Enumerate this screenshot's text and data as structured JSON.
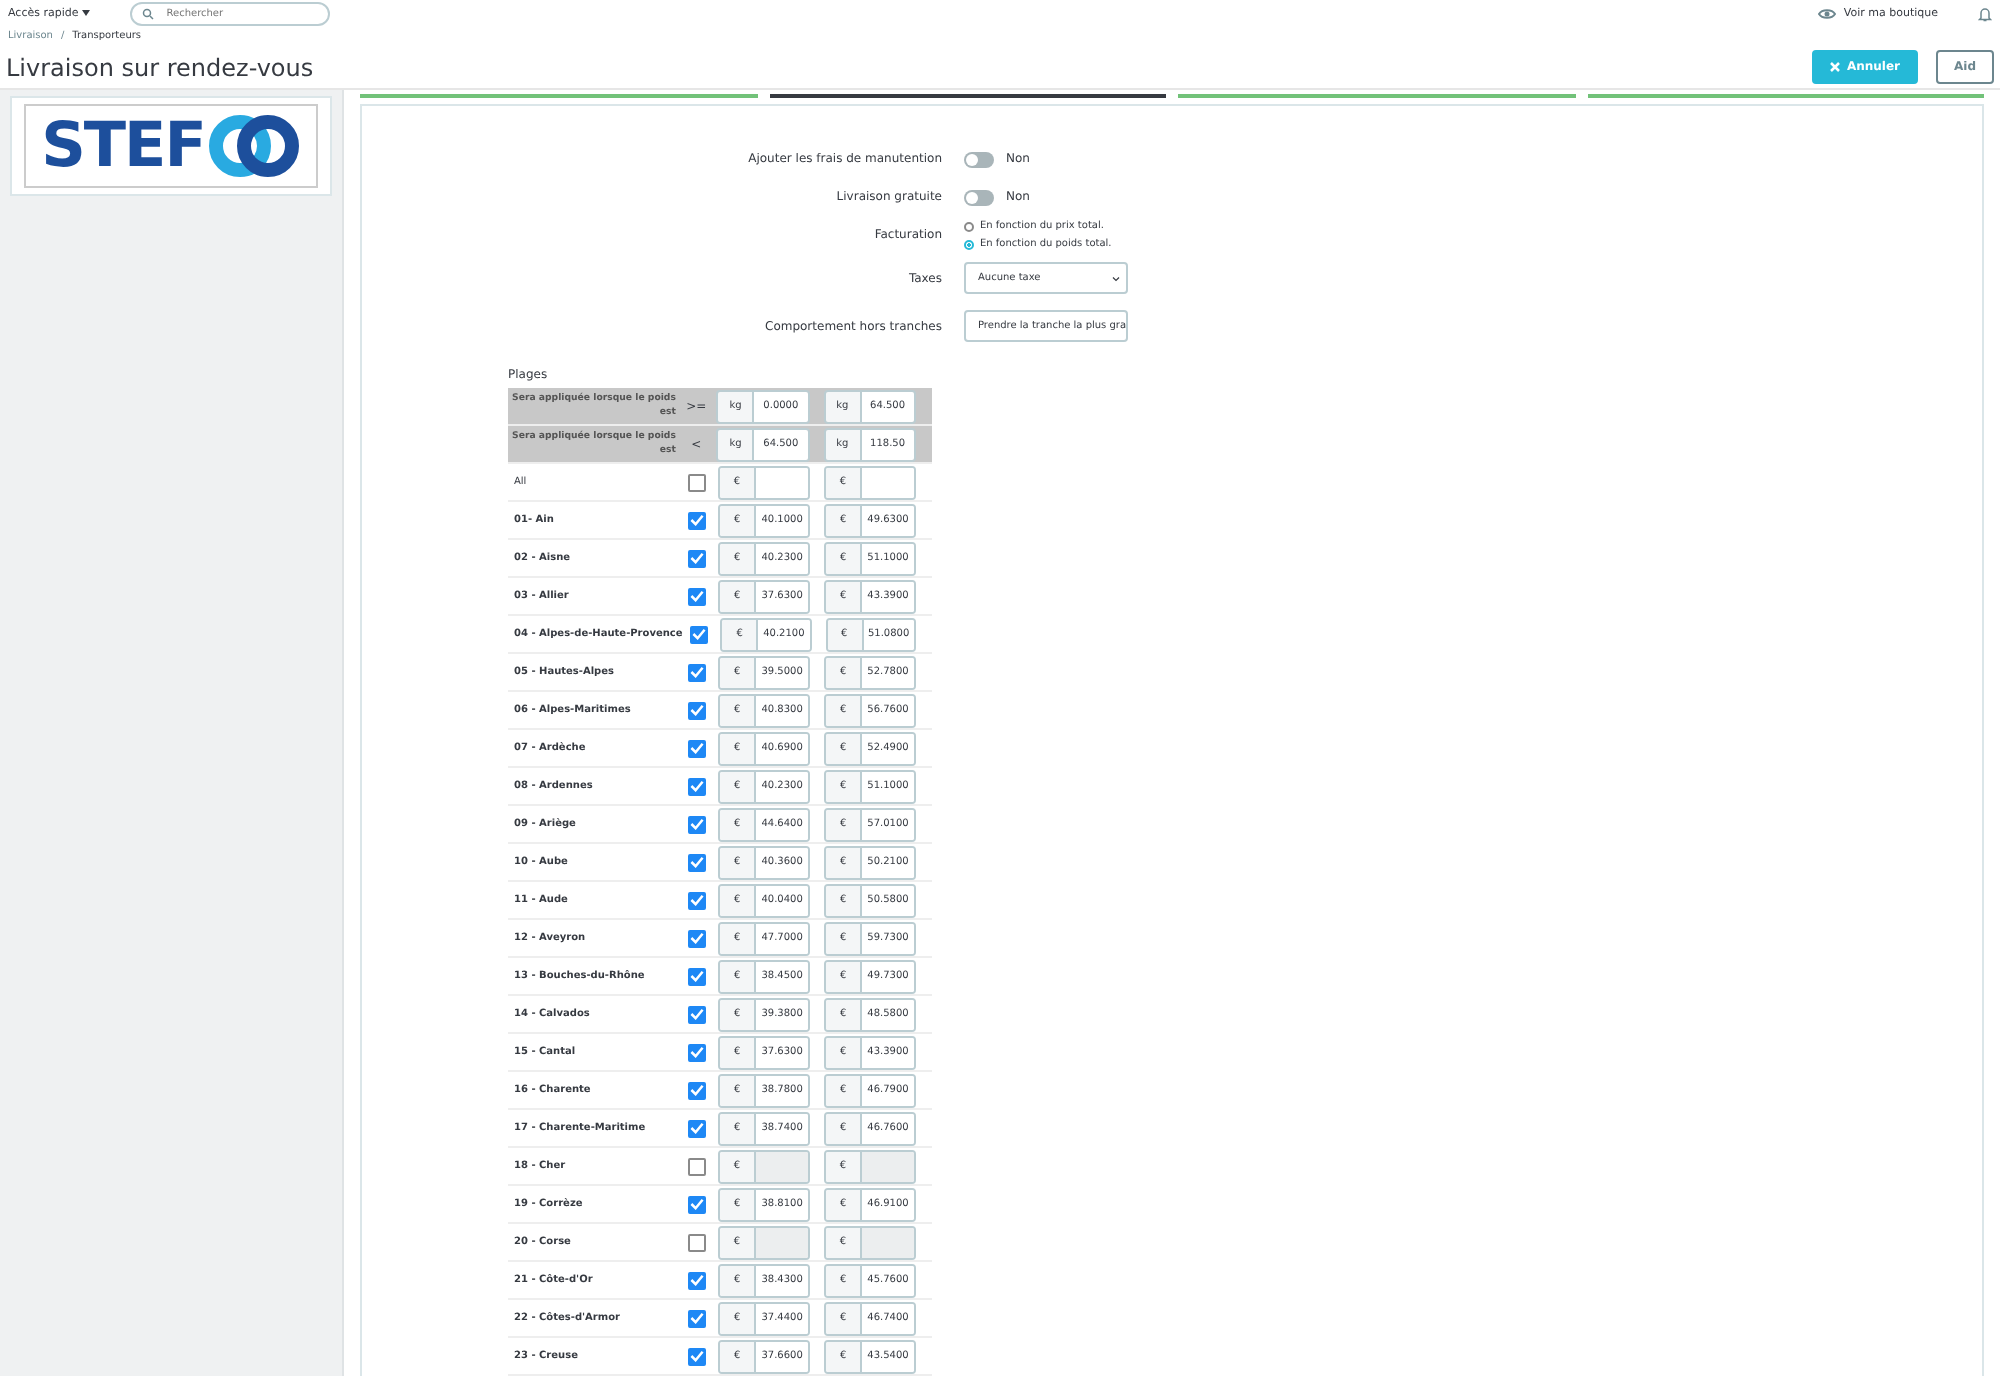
{
  "topbar": {
    "quick_access": "Accès rapide",
    "search": {
      "placeholder": "Rechercher"
    },
    "shop_link": "Voir ma boutique"
  },
  "breadcrumb": {
    "separator": "/",
    "items": [
      "Livraison",
      "Transporteurs"
    ]
  },
  "title": "Livraison sur rendez-vous",
  "actions": [
    {
      "kind": "primary",
      "label": "Annuler"
    },
    {
      "kind": "secondary",
      "label": "Aid"
    }
  ],
  "logo": {
    "text": "STEF"
  },
  "steps": [
    {
      "selected": false
    },
    {
      "selected": true
    },
    {
      "selected": false
    },
    {
      "selected": false
    }
  ],
  "form": {
    "fields": [
      {
        "kind": "toggle",
        "label": "Ajouter les frais de manutention",
        "on": false,
        "value": "Non"
      },
      {
        "kind": "toggle",
        "label": "Livraison gratuite",
        "on": false,
        "value": "Non"
      },
      {
        "kind": "radio",
        "label": "Facturation",
        "options": [
          {
            "label": "En fonction du prix total.",
            "selected": false
          },
          {
            "label": "En fonction du poids total.",
            "selected": true
          }
        ]
      },
      {
        "kind": "select",
        "label": "Taxes",
        "value": "Aucune taxe"
      },
      {
        "kind": "select",
        "label": "Comportement hors tranches",
        "value": "Prendre la tranche la plus gra"
      }
    ]
  },
  "ranges": {
    "title": "Plages",
    "headers": [
      {
        "label": "Sera appliquée lorsque le poids est",
        "operator": ">=",
        "unit_1": "kg",
        "value_1": "0.0000",
        "unit_2": "kg",
        "value_2": "64.500"
      },
      {
        "label": "Sera appliquée lorsque le poids est",
        "operator": "<",
        "unit_1": "kg",
        "value_1": "64.500",
        "unit_2": "kg",
        "value_2": "118.50"
      }
    ],
    "currency": "€",
    "rows": [
      {
        "zone": "All",
        "checked": false,
        "price_1": "",
        "price_2": "",
        "kind": "all"
      },
      {
        "zone": "01- Ain",
        "checked": true,
        "price_1": "40.1000",
        "price_2": "49.6300"
      },
      {
        "zone": "02 - Aisne",
        "checked": true,
        "price_1": "40.2300",
        "price_2": "51.1000"
      },
      {
        "zone": "03 - Allier",
        "checked": true,
        "price_1": "37.6300",
        "price_2": "43.3900"
      },
      {
        "zone": "04 - Alpes-de-Haute-Provence",
        "checked": true,
        "price_1": "40.2100",
        "price_2": "51.0800"
      },
      {
        "zone": "05 - Hautes-Alpes",
        "checked": true,
        "price_1": "39.5000",
        "price_2": "52.7800"
      },
      {
        "zone": "06 - Alpes-Maritimes",
        "checked": true,
        "price_1": "40.8300",
        "price_2": "56.7600"
      },
      {
        "zone": "07 - Ardèche",
        "checked": true,
        "price_1": "40.6900",
        "price_2": "52.4900"
      },
      {
        "zone": "08 - Ardennes",
        "checked": true,
        "price_1": "40.2300",
        "price_2": "51.1000"
      },
      {
        "zone": "09 - Ariège",
        "checked": true,
        "price_1": "44.6400",
        "price_2": "57.0100"
      },
      {
        "zone": "10 - Aube",
        "checked": true,
        "price_1": "40.3600",
        "price_2": "50.2100"
      },
      {
        "zone": "11 - Aude",
        "checked": true,
        "price_1": "40.0400",
        "price_2": "50.5800"
      },
      {
        "zone": "12 - Aveyron",
        "checked": true,
        "price_1": "47.7000",
        "price_2": "59.7300"
      },
      {
        "zone": "13 - Bouches-du-Rhône",
        "checked": true,
        "price_1": "38.4500",
        "price_2": "49.7300"
      },
      {
        "zone": "14 - Calvados",
        "checked": true,
        "price_1": "39.3800",
        "price_2": "48.5800"
      },
      {
        "zone": "15 - Cantal",
        "checked": true,
        "price_1": "37.6300",
        "price_2": "43.3900"
      },
      {
        "zone": "16 - Charente",
        "checked": true,
        "price_1": "38.7800",
        "price_2": "46.7900"
      },
      {
        "zone": "17 - Charente-Maritime",
        "checked": true,
        "price_1": "38.7400",
        "price_2": "46.7600"
      },
      {
        "zone": "18 - Cher",
        "checked": false,
        "price_1": "",
        "price_2": ""
      },
      {
        "zone": "19 - Corrèze",
        "checked": true,
        "price_1": "38.8100",
        "price_2": "46.9100"
      },
      {
        "zone": "20 - Corse",
        "checked": false,
        "price_1": "",
        "price_2": ""
      },
      {
        "zone": "21 - Côte-d'Or",
        "checked": true,
        "price_1": "38.4300",
        "price_2": "45.7600"
      },
      {
        "zone": "22 - Côtes-d'Armor",
        "checked": true,
        "price_1": "37.4400",
        "price_2": "46.7400"
      },
      {
        "zone": "23 - Creuse",
        "checked": true,
        "price_1": "37.6600",
        "price_2": "43.5400"
      }
    ]
  }
}
